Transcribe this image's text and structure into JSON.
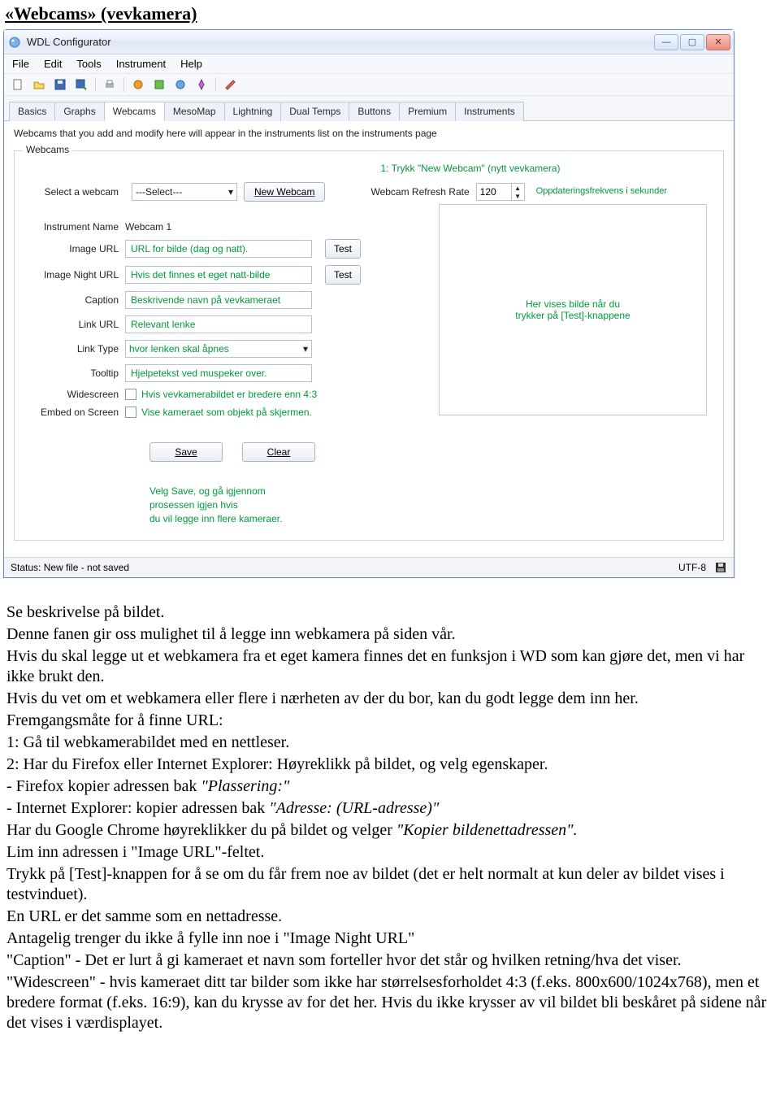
{
  "doc_title": "«Webcams» (vevkamera)",
  "window": {
    "title": "WDL Configurator",
    "menus": [
      "File",
      "Edit",
      "Tools",
      "Instrument",
      "Help"
    ],
    "tabs": [
      "Basics",
      "Graphs",
      "Webcams",
      "MesoMap",
      "Lightning",
      "Dual Temps",
      "Buttons",
      "Premium",
      "Instruments"
    ],
    "active_tab": "Webcams",
    "hint": "Webcams that you add and modify here will appear in the instruments list on the instruments page",
    "group_legend": "Webcams",
    "topline_green": "1: Trykk \"New Webcam\" (nytt vevkamera)",
    "select_label": "Select a webcam",
    "select_value": "---Select---",
    "new_webcam_btn": "New Webcam",
    "refresh_label": "Webcam Refresh Rate",
    "refresh_value": "120",
    "refresh_note": "Oppdateringsfrekvens i sekunder",
    "fields": {
      "instrument_name": {
        "label": "Instrument Name",
        "value": "Webcam 1"
      },
      "image_url": {
        "label": "Image URL",
        "value": "URL for bilde (dag og natt).",
        "test": "Test"
      },
      "image_night_url": {
        "label": "Image Night URL",
        "value": "Hvis det finnes et eget natt-bilde",
        "test": "Test"
      },
      "caption": {
        "label": "Caption",
        "value": "Beskrivende navn på vevkameraet"
      },
      "link_url": {
        "label": "Link URL",
        "value": "Relevant lenke"
      },
      "link_type": {
        "label": "Link Type",
        "value": "hvor lenken skal åpnes"
      },
      "tooltip": {
        "label": "Tooltip",
        "value": "Hjelpetekst ved muspeker over."
      },
      "widescreen": {
        "label": "Widescreen",
        "note": "Hvis vevkamerabildet er bredere enn 4:3"
      },
      "embed": {
        "label": "Embed on Screen",
        "note": "Vise kameraet som objekt på skjermen."
      }
    },
    "preview_note_line1": "Her vises bilde når du",
    "preview_note_line2": "trykker på [Test]-knappene",
    "save_btn": "Save",
    "clear_btn": "Clear",
    "save_note_line1": "Velg Save, og gå igjennom prosessen igjen hvis",
    "save_note_line2": "du vil legge inn flere kameraer.",
    "status_left": "Status: New file - not saved",
    "status_right": "UTF-8"
  },
  "body": {
    "p1": "Se beskrivelse på bildet.",
    "p2": "Denne fanen gir oss mulighet til å legge inn webkamera på siden vår.",
    "p3": "Hvis du skal legge ut et webkamera fra et eget kamera finnes det en funksjon i WD som kan gjøre det, men vi har ikke brukt den.",
    "p4": "Hvis du vet om et webkamera eller flere i nærheten av der du bor, kan du godt legge dem inn her.",
    "p5": "Fremgangsmåte for å finne URL:",
    "p6": "1: Gå til webkamerabildet med en nettleser.",
    "p7": "2: Har du Firefox eller Internet Explorer: Høyreklikk på bildet, og velg egenskaper.",
    "p8a": "- Firefox kopier adressen bak ",
    "p8b": "\"Plassering:\"",
    "p9a": "- Internet Explorer: kopier adressen bak ",
    "p9b": "\"Adresse: (URL-adresse)\"",
    "p10a": "Har du Google Chrome høyreklikker du på bildet og velger ",
    "p10b": "\"Kopier bildenettadressen\".",
    "p11": "Lim inn adressen i \"Image URL\"-feltet.",
    "p12": "Trykk på [Test]-knappen for å se om du får frem noe av bildet (det er helt normalt at kun deler av bildet vises i testvinduet).",
    "p13": "En URL er det samme som en nettadresse.",
    "p14": "Antagelig trenger du ikke å fylle inn noe i \"Image Night URL\"",
    "p15": "\"Caption\" - Det er lurt å gi kameraet et navn som forteller hvor det står og hvilken retning/hva det viser.",
    "p16": "\"Widescreen\" - hvis kameraet ditt tar bilder som ikke har størrelsesforholdet 4:3 (f.eks. 800x600/1024x768), men et bredere format (f.eks. 16:9), kan du krysse av for det her. Hvis du ikke krysser av vil bildet bli beskåret på sidene når det vises i værdisplayet."
  }
}
